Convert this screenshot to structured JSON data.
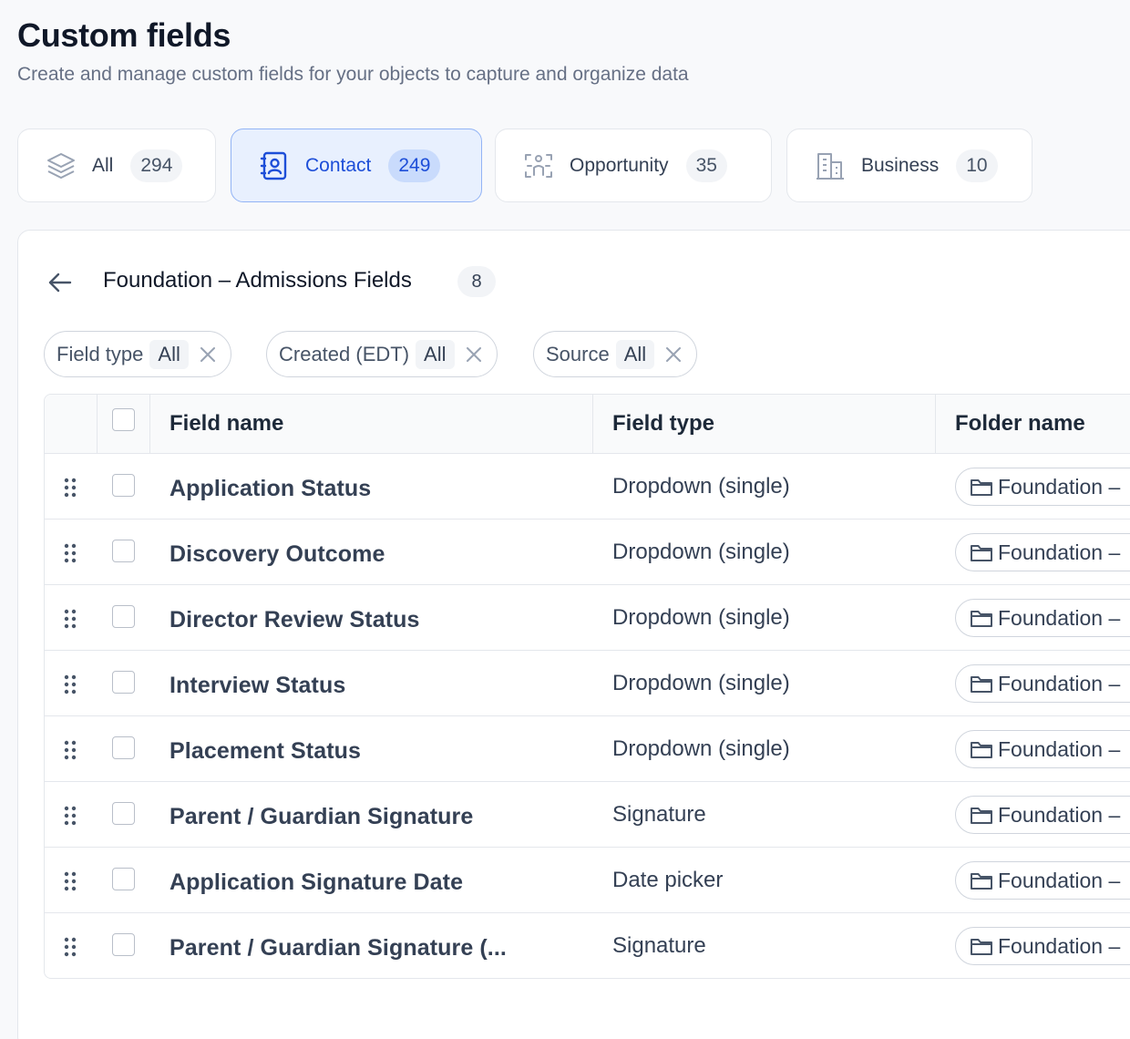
{
  "header": {
    "title": "Custom fields",
    "subtitle": "Create and manage custom fields for your objects to capture and organize data"
  },
  "tabs": [
    {
      "label": "All",
      "count": "294",
      "icon": "layers-icon",
      "active": false
    },
    {
      "label": "Contact",
      "count": "249",
      "icon": "contact-book-icon",
      "active": true
    },
    {
      "label": "Opportunity",
      "count": "35",
      "icon": "opportunity-icon",
      "active": false
    },
    {
      "label": "Business",
      "count": "10",
      "icon": "building-icon",
      "active": false
    }
  ],
  "folder": {
    "title": "Foundation – Admissions Fields",
    "count": "8"
  },
  "filters": [
    {
      "label": "Field type",
      "value": "All"
    },
    {
      "label": "Created (EDT)",
      "value": "All"
    },
    {
      "label": "Source",
      "value": "All"
    }
  ],
  "table": {
    "columns": {
      "name": "Field name",
      "type": "Field type",
      "folder": "Folder name"
    },
    "rows": [
      {
        "name": "Application Status",
        "type": "Dropdown (single)",
        "folder": "Foundation –"
      },
      {
        "name": "Discovery Outcome",
        "type": "Dropdown (single)",
        "folder": "Foundation –"
      },
      {
        "name": "Director Review Status",
        "type": "Dropdown (single)",
        "folder": "Foundation –"
      },
      {
        "name": "Interview Status",
        "type": "Dropdown (single)",
        "folder": "Foundation –"
      },
      {
        "name": "Placement Status",
        "type": "Dropdown (single)",
        "folder": "Foundation –"
      },
      {
        "name": "Parent / Guardian Signature",
        "type": "Signature",
        "folder": "Foundation –"
      },
      {
        "name": "Application Signature Date",
        "type": "Date picker",
        "folder": "Foundation –"
      },
      {
        "name": "Parent / Guardian Signature (...",
        "type": "Signature",
        "folder": "Foundation –"
      }
    ]
  },
  "colors": {
    "accent": "#1d4ed8",
    "active_tab_bg": "#e8f0fe",
    "border": "#e4e7ec"
  }
}
